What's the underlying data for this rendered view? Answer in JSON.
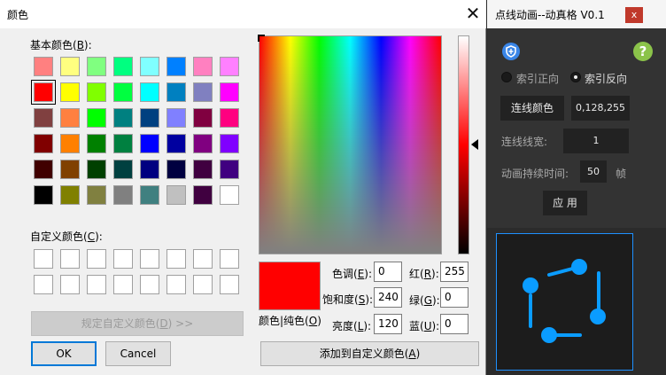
{
  "dialog": {
    "title": "颜色",
    "close_glyph": "✕",
    "basic_colors_label": {
      "text": "基本颜色(",
      "key": "B",
      "end": "):"
    },
    "basic_colors": [
      [
        "#ff8080",
        "#ffff80",
        "#80ff80",
        "#00ff80",
        "#80ffff",
        "#0080ff",
        "#ff80c0",
        "#ff80ff"
      ],
      [
        "#ff0000",
        "#ffff00",
        "#80ff00",
        "#00ff40",
        "#00ffff",
        "#0080c0",
        "#8080c0",
        "#ff00ff"
      ],
      [
        "#804040",
        "#ff8040",
        "#00ff00",
        "#008080",
        "#004080",
        "#8080ff",
        "#800040",
        "#ff0080"
      ],
      [
        "#800000",
        "#ff8000",
        "#008000",
        "#008040",
        "#0000ff",
        "#0000a0",
        "#800080",
        "#8000ff"
      ],
      [
        "#400000",
        "#804000",
        "#004000",
        "#004040",
        "#000080",
        "#000040",
        "#400040",
        "#400080"
      ],
      [
        "#000000",
        "#808000",
        "#808040",
        "#808080",
        "#408080",
        "#c0c0c0",
        "#400040",
        "#ffffff"
      ]
    ],
    "selected_swatch": "1-0",
    "custom_colors_label": {
      "text": "自定义颜色(",
      "key": "C",
      "end": "):"
    },
    "define_custom_button": {
      "text": "规定自定义颜色(",
      "key": "D",
      "end": ") >>"
    },
    "ok_button": "OK",
    "cancel_button": "Cancel",
    "color_solid_label": {
      "text": "颜色|纯色(",
      "key": "O",
      "end": ")"
    },
    "hue": {
      "text": "色调(",
      "key": "E",
      "end": "):",
      "value": "0"
    },
    "sat": {
      "text": "饱和度(",
      "key": "S",
      "end": "):",
      "value": "240"
    },
    "lum": {
      "text": "亮度(",
      "key": "L",
      "end": "):",
      "value": "120"
    },
    "red": {
      "text": "红(",
      "key": "R",
      "end": "):",
      "value": "255"
    },
    "green": {
      "text": "绿(",
      "key": "G",
      "end": "):",
      "value": "0"
    },
    "blue": {
      "text": "蓝(",
      "key": "U",
      "end": "):",
      "value": "0"
    },
    "add_custom_button": {
      "text": "添加到自定义颜色(",
      "key": "A",
      "end": ")"
    },
    "current_color": "#ff0000"
  },
  "tool": {
    "title": "点线动画--动真格 V0.1",
    "close_label": "x",
    "shield_icon": "shield-icon",
    "help_icon": "help-icon",
    "help_glyph": "?",
    "radio_forward": "索引正向",
    "radio_reverse": "索引反向",
    "radio_selected": "reverse",
    "line_color_button": "连线颜色",
    "line_color_value": "0,128,255",
    "line_width_label": "连线线宽:",
    "line_width_value": "1",
    "duration_label": "动画持续时间:",
    "duration_value": "50",
    "duration_unit": "帧",
    "apply_button": "应 用",
    "accent_color": "#1e90ff",
    "dot_color": "#0a9cff"
  }
}
